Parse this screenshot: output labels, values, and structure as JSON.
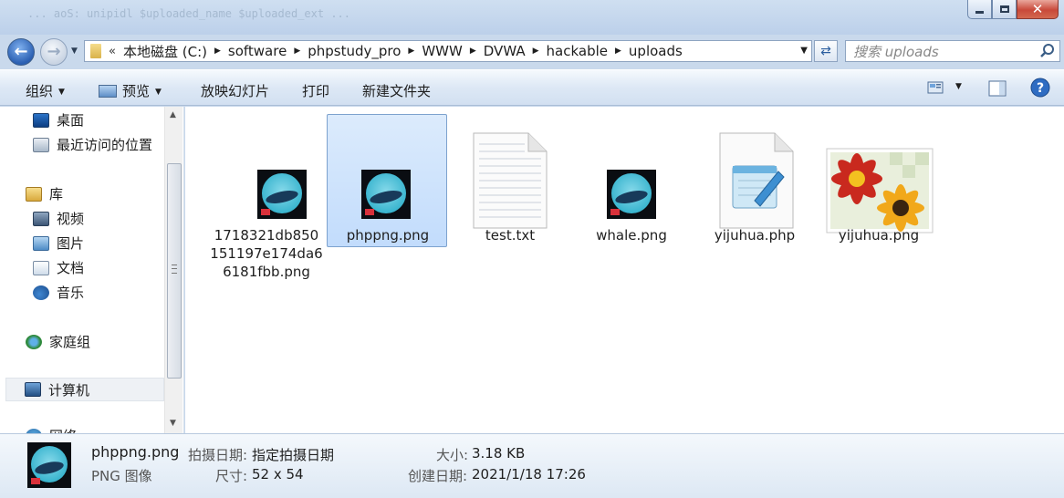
{
  "window": {
    "background_text": "... aoS:  unipidl   $uploaded_name   $uploaded_ext ...",
    "minimize_icon": "minimize-icon",
    "maximize_icon": "maximize-icon",
    "close_icon": "close-icon"
  },
  "address_bar": {
    "more": "«",
    "crumbs": [
      "本地磁盘 (C:)",
      "software",
      "phpstudy_pro",
      "WWW",
      "DVWA",
      "hackable",
      "uploads"
    ]
  },
  "search": {
    "placeholder": "搜索 uploads"
  },
  "toolbar": {
    "organize": "组织",
    "preview": "预览",
    "slideshow": "放映幻灯片",
    "print": "打印",
    "new_folder": "新建文件夹"
  },
  "nav_pane": {
    "desktop": "桌面",
    "recent": "最近访问的位置",
    "libraries": "库",
    "videos": "视频",
    "pictures": "图片",
    "documents": "文档",
    "music": "音乐",
    "homegroup": "家庭组",
    "computer": "计算机",
    "network_partial": "网络"
  },
  "files": [
    {
      "name": "1718321db850151197e174da66181fbb.png",
      "type": "whale-png"
    },
    {
      "name": "phppng.png",
      "type": "whale-png",
      "selected": true
    },
    {
      "name": "test.txt",
      "type": "text-file"
    },
    {
      "name": "whale.png",
      "type": "whale-png"
    },
    {
      "name": "yijuhua.php",
      "type": "notepad-file"
    },
    {
      "name": "yijuhua.png",
      "type": "flower-image"
    }
  ],
  "details": {
    "name": "phppng.png",
    "type": "PNG 图像",
    "taken_label": "拍摄日期:",
    "taken_value": "指定拍摄日期",
    "dimensions_label": "尺寸:",
    "dimensions_value": "52 x 54",
    "size_label": "大小:",
    "size_value": "3.18 KB",
    "created_label": "创建日期:",
    "created_value": "2021/1/18 17:26"
  }
}
